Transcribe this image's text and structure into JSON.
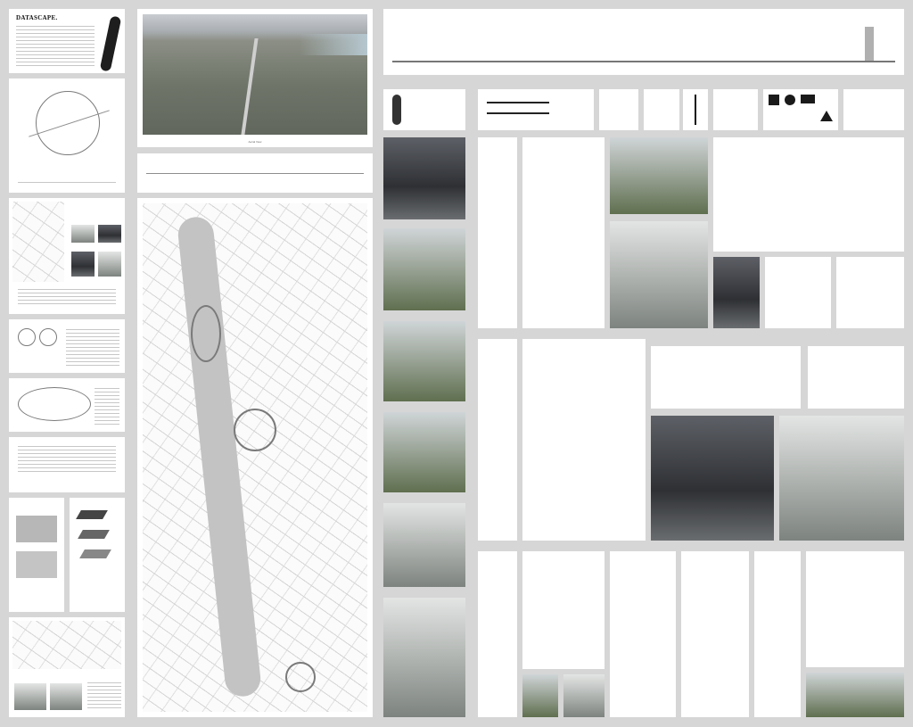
{
  "board": {
    "title": "DATASCAPE.",
    "aerial_caption": "Aerial View"
  },
  "colors": {
    "background": "#d6d6d6",
    "panel": "#ffffff",
    "linework": "#8d8d8d"
  }
}
